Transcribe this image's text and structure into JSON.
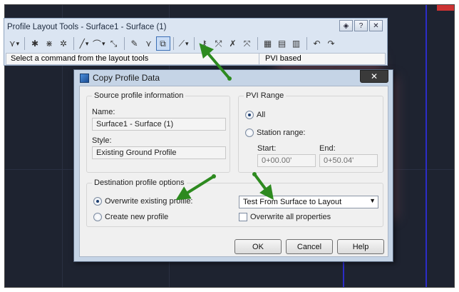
{
  "toolbar": {
    "title": "Profile Layout Tools - Surface1 - Surface (1)",
    "title_buttons": {
      "settings": "◈",
      "help": "?",
      "close": "✕"
    },
    "status_command": "Select a command from the layout tools",
    "status_mode": "PVI based"
  },
  "dialog": {
    "title": "Copy Profile Data",
    "close_glyph": "✕",
    "source": {
      "group_label": "Source profile information",
      "name_label": "Name:",
      "name_value": "Surface1 - Surface (1)",
      "style_label": "Style:",
      "style_value": "Existing Ground Profile"
    },
    "pvi_range": {
      "group_label": "PVI Range",
      "all_label": "All",
      "station_label": "Station range:",
      "start_label": "Start:",
      "start_value": "0+00.00'",
      "end_label": "End:",
      "end_value": "0+50.04'"
    },
    "destination": {
      "group_label": "Destination profile options",
      "overwrite_label": "Overwrite existing profile:",
      "create_label": "Create new profile",
      "profile_select_value": "Test From Surface to Layout",
      "overwrite_all_label": "Overwrite all properties"
    },
    "buttons": {
      "ok": "OK",
      "cancel": "Cancel",
      "help": "Help"
    }
  },
  "colors": {
    "annotation_arrow": "#2d8a1f",
    "canvas_bg": "#1e2330"
  }
}
